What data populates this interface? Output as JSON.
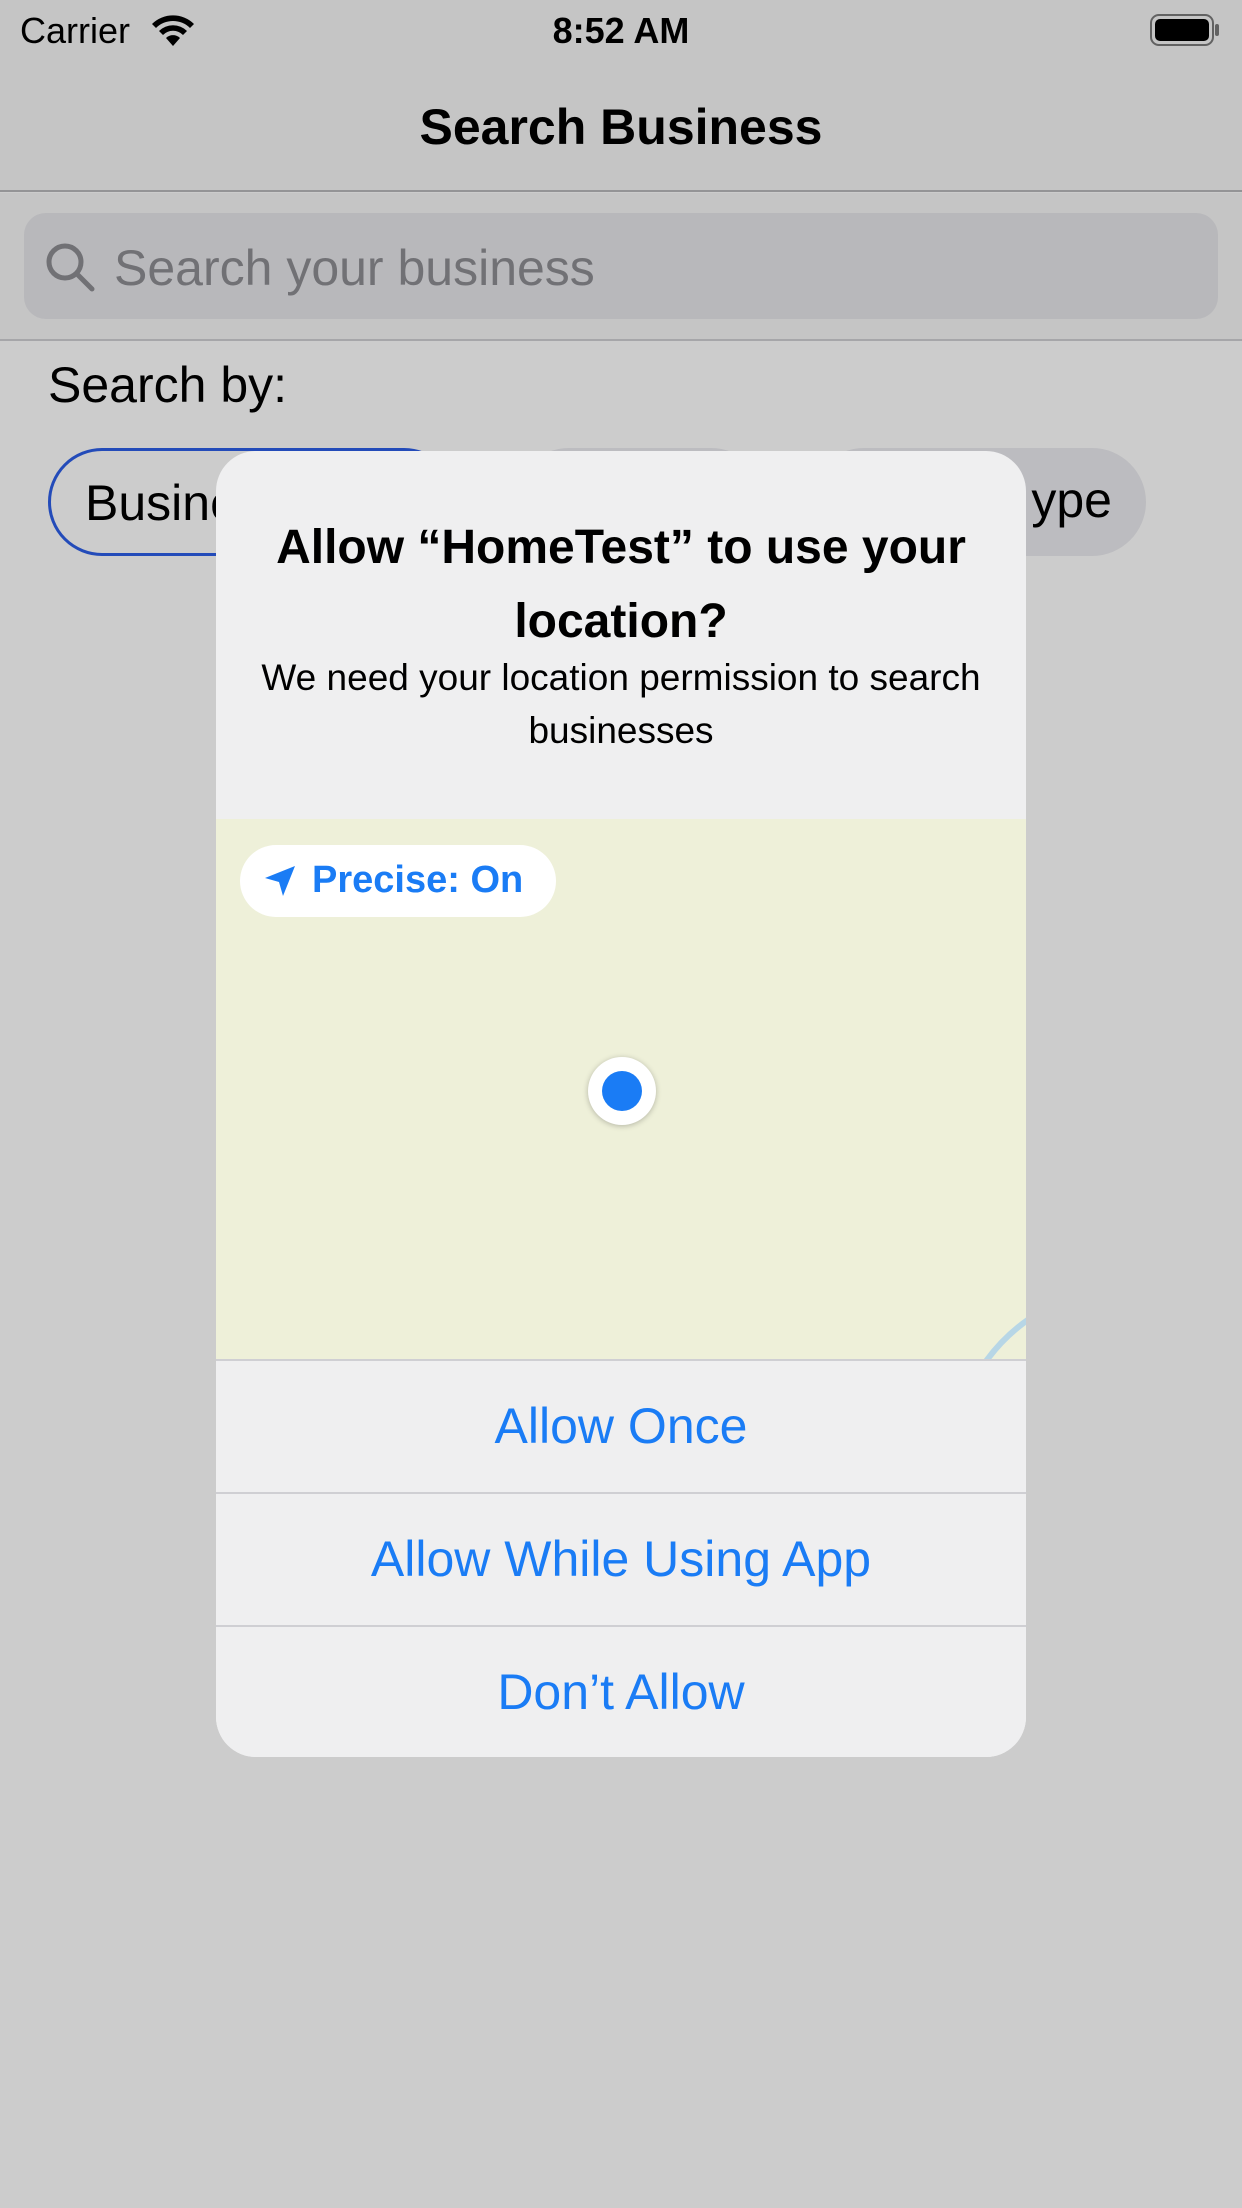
{
  "status_bar": {
    "carrier": "Carrier",
    "time": "8:52 AM"
  },
  "nav": {
    "title": "Search Business"
  },
  "search": {
    "placeholder": "Search your business"
  },
  "search_by": {
    "label": "Search by:",
    "chips": [
      {
        "label": "Busine"
      },
      {
        "label": ""
      },
      {
        "label": "ype"
      }
    ]
  },
  "alert": {
    "title": "Allow “HomeTest” to use your location?",
    "message": "We need your location permission to search businesses",
    "precise_label": "Precise: On",
    "buttons": {
      "allow_once": "Allow Once",
      "allow_while_using": "Allow While Using App",
      "dont_allow": "Don’t Allow"
    }
  },
  "colors": {
    "accent": "#1a7cf5",
    "map_bg": "#eef0d9",
    "alert_bg": "#efeff0"
  },
  "icons": [
    "wifi-icon",
    "battery-icon",
    "search-icon",
    "location-arrow-icon",
    "location-dot-icon"
  ]
}
